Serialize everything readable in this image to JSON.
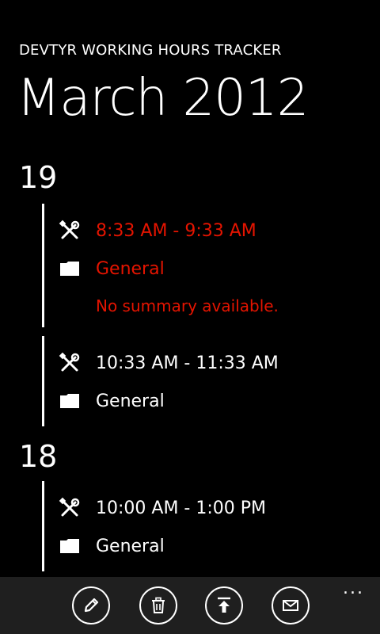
{
  "app": {
    "title": "DEVTYR WORKING HOURS TRACKER",
    "page_title": "March 2012"
  },
  "colors": {
    "accent": "#e51400",
    "background": "#000000",
    "foreground": "#ffffff",
    "app_bar": "#1f1f1f"
  },
  "days": [
    {
      "day": "19",
      "entries": [
        {
          "time": "8:33 AM - 9:33 AM",
          "project": "General",
          "summary": "No summary available.",
          "selected": true,
          "time_icon": "tools-icon",
          "project_icon": "folder-icon"
        },
        {
          "time": "10:33 AM - 11:33 AM",
          "project": "General",
          "selected": false,
          "time_icon": "tools-icon",
          "project_icon": "folder-icon"
        }
      ]
    },
    {
      "day": "18",
      "entries": [
        {
          "time": "10:00 AM - 1:00 PM",
          "project": "General",
          "selected": false,
          "time_icon": "tools-icon",
          "project_icon": "folder-icon"
        }
      ]
    }
  ],
  "app_bar": {
    "buttons": [
      "edit-icon",
      "delete-icon",
      "upload-icon",
      "email-icon"
    ],
    "more_label": "..."
  }
}
